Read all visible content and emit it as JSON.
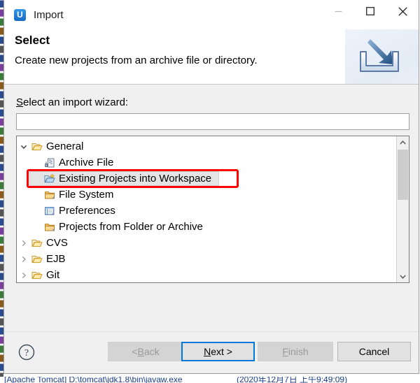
{
  "window": {
    "icon_name": "app-icon-u",
    "icon_letter": "U",
    "title": "Import",
    "minimize_label": "—",
    "maximize_label": "□",
    "close_label": "×"
  },
  "header": {
    "title": "Select",
    "description": "Create new projects from an archive file or directory.",
    "banner_icon_name": "import-banner-icon"
  },
  "form": {
    "wizard_label_prefix": "S",
    "wizard_label_rest": "elect an import wizard:",
    "filter_value": "",
    "filter_placeholder": ""
  },
  "tree": {
    "items": [
      {
        "label": "General",
        "level": 0,
        "expander": "expanded",
        "icon": "folder-open-icon",
        "selected": false
      },
      {
        "label": "Archive File",
        "level": 1,
        "expander": "none",
        "icon": "archive-file-icon",
        "selected": false
      },
      {
        "label": "Existing Projects into Workspace",
        "level": 1,
        "expander": "none",
        "icon": "import-project-folder-icon",
        "selected": true
      },
      {
        "label": "File System",
        "level": 1,
        "expander": "none",
        "icon": "folder-icon",
        "selected": false
      },
      {
        "label": "Preferences",
        "level": 1,
        "expander": "none",
        "icon": "preferences-icon",
        "selected": false
      },
      {
        "label": "Projects from Folder or Archive",
        "level": 1,
        "expander": "none",
        "icon": "folder-icon",
        "selected": false
      },
      {
        "label": "CVS",
        "level": 0,
        "expander": "collapsed",
        "icon": "folder-open-icon",
        "selected": false
      },
      {
        "label": "EJB",
        "level": 0,
        "expander": "collapsed",
        "icon": "folder-open-icon",
        "selected": false
      },
      {
        "label": "Git",
        "level": 0,
        "expander": "collapsed",
        "icon": "folder-open-icon",
        "selected": false
      }
    ],
    "scrollbar": {
      "up_arrow": "scroll-up-arrow",
      "down_arrow": "scroll-down-arrow"
    }
  },
  "annotation": {
    "highlight_color": "#ff0000",
    "target_label": "Existing Projects into Workspace"
  },
  "footer": {
    "help_icon": "help-icon",
    "buttons": [
      {
        "name": "back",
        "label": "< Back",
        "mnemonic": "B",
        "state": "disabled"
      },
      {
        "name": "next",
        "label": "Next >",
        "mnemonic": "N",
        "state": "focused"
      },
      {
        "name": "finish",
        "label": "Finish",
        "mnemonic": "F",
        "state": "disabled"
      },
      {
        "name": "cancel",
        "label": "Cancel",
        "mnemonic": "",
        "state": "enabled"
      }
    ],
    "back_label_pre": "< ",
    "back_label_mn": "B",
    "back_label_post": "ack",
    "next_label_mn": "N",
    "next_label_post": "ext >",
    "finish_label_mn": "F",
    "finish_label_post": "inish",
    "cancel_label": "Cancel"
  },
  "background": {
    "console_left": "[Apache Tomcat] D:\\tomcat\\jdk1.8\\bin\\javaw.exe",
    "console_right": "(2020年12月7日 上午9:49:09)"
  }
}
